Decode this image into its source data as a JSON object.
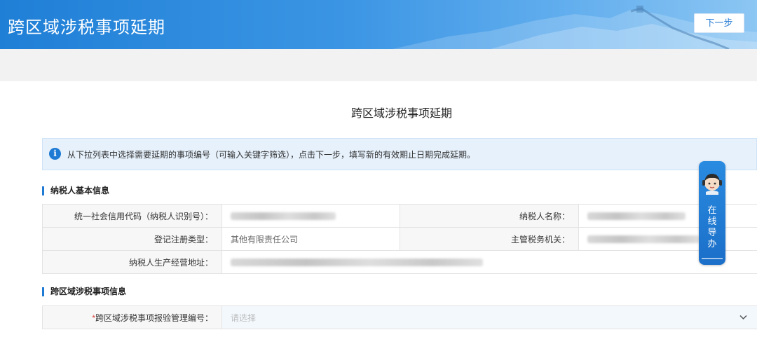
{
  "header": {
    "title": "跨区域涉税事项延期",
    "next_label": "下一步"
  },
  "page_title": "跨区域涉税事项延期",
  "notice": {
    "icon": "info-icon",
    "icon_glyph": "i",
    "text": "从下拉列表中选择需要延期的事项编号（可输入关键字筛选），点击下一步，填写新的有效期止日期完成延期。"
  },
  "basic_section": {
    "title": "纳税人基本信息",
    "rows": [
      {
        "label": "统一社会信用代码（纳税人识别号）：",
        "value": "",
        "label2": "纳税人名称：",
        "value2": ""
      },
      {
        "label": "登记注册类型：",
        "value": "其他有限责任公司",
        "label2": "主管税务机关：",
        "value2": ""
      },
      {
        "label": "纳税人生产经营地址：",
        "value": ""
      }
    ]
  },
  "matter_section": {
    "title": "跨区域涉税事项信息",
    "field_required_mark": "*",
    "field_label": "跨区域涉税事项报验管理编号：",
    "field_placeholder": "请选择",
    "field_icon": "chevron-down-icon"
  },
  "online_service": {
    "label": "在\n线\n导\n办",
    "icon": "agent-avatar-icon"
  },
  "colors": {
    "brand_blue": "#1e7ad3",
    "required_red": "#e04040",
    "notice_bg": "#e6f1fc"
  }
}
